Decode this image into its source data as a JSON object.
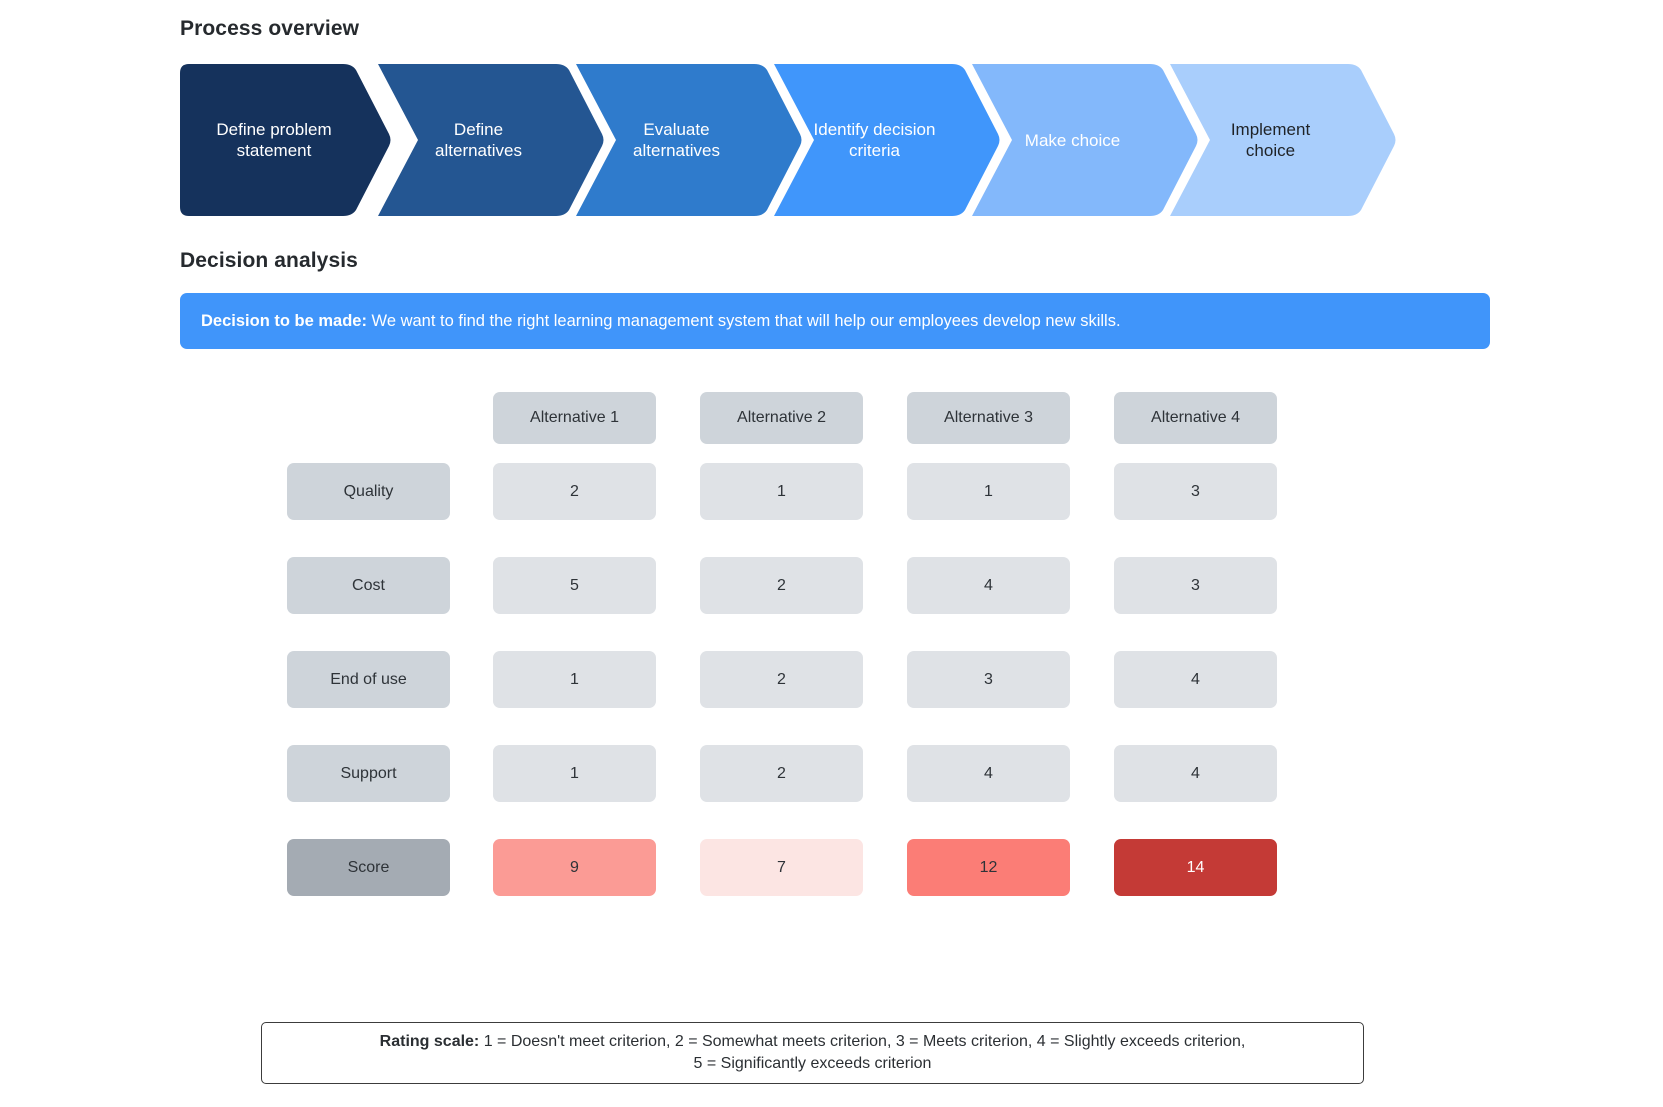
{
  "process": {
    "title": "Process overview",
    "steps": [
      {
        "label": "Define problem\nstatement",
        "color": "#15325c",
        "text_color": "#ffffff"
      },
      {
        "label": "Define\nalternatives",
        "color": "#245692",
        "text_color": "#ffffff"
      },
      {
        "label": "Evaluate\nalternatives",
        "color": "#2f7bcc",
        "text_color": "#ffffff"
      },
      {
        "label": "Identify decision\ncriteria",
        "color": "#4096fb",
        "text_color": "#ffffff"
      },
      {
        "label": "Make choice",
        "color": "#83b8fb",
        "text_color": "#ffffff"
      },
      {
        "label": "Implement\nchoice",
        "color": "#a9cefc",
        "text_color": "#1f2327"
      }
    ]
  },
  "analysis": {
    "title": "Decision analysis",
    "banner": {
      "label": "Decision to be made:",
      "text": " We want to find the right learning management system that will help our employees develop new skills.",
      "background": "#4095fa",
      "text_color": "#ffffff"
    }
  },
  "matrix": {
    "corner": "",
    "columns": [
      "Alternative 1",
      "Alternative 2",
      "Alternative 3",
      "Alternative 4"
    ],
    "rows": [
      {
        "criterion": "Quality",
        "values": [
          "2",
          "1",
          "1",
          "3"
        ]
      },
      {
        "criterion": "Cost",
        "values": [
          "5",
          "2",
          "4",
          "3"
        ]
      },
      {
        "criterion": "End of use",
        "values": [
          "1",
          "2",
          "3",
          "4"
        ]
      },
      {
        "criterion": "Support",
        "values": [
          "1",
          "2",
          "4",
          "4"
        ]
      }
    ],
    "score_row": {
      "criterion": "Score",
      "values": [
        "9",
        "7",
        "12",
        "14"
      ],
      "colors": [
        "#fb9b95",
        "#fce5e3",
        "#fb7d76",
        "#c43a36"
      ],
      "text_colors": [
        "#2e3338",
        "#2e3338",
        "#2e3338",
        "#ffffff"
      ]
    },
    "header_color": "#ced4da",
    "cell_color": "#dfe2e6",
    "criterion_color": "#ced4da",
    "score_criterion_color": "#a4abb3"
  },
  "rating_scale": {
    "label": "Rating scale:",
    "line1": " 1 = Doesn't meet criterion, 2 = Somewhat meets criterion, 3 = Meets criterion, 4 = Slightly exceeds criterion,",
    "line2": "5 = Significantly exceeds criterion"
  }
}
